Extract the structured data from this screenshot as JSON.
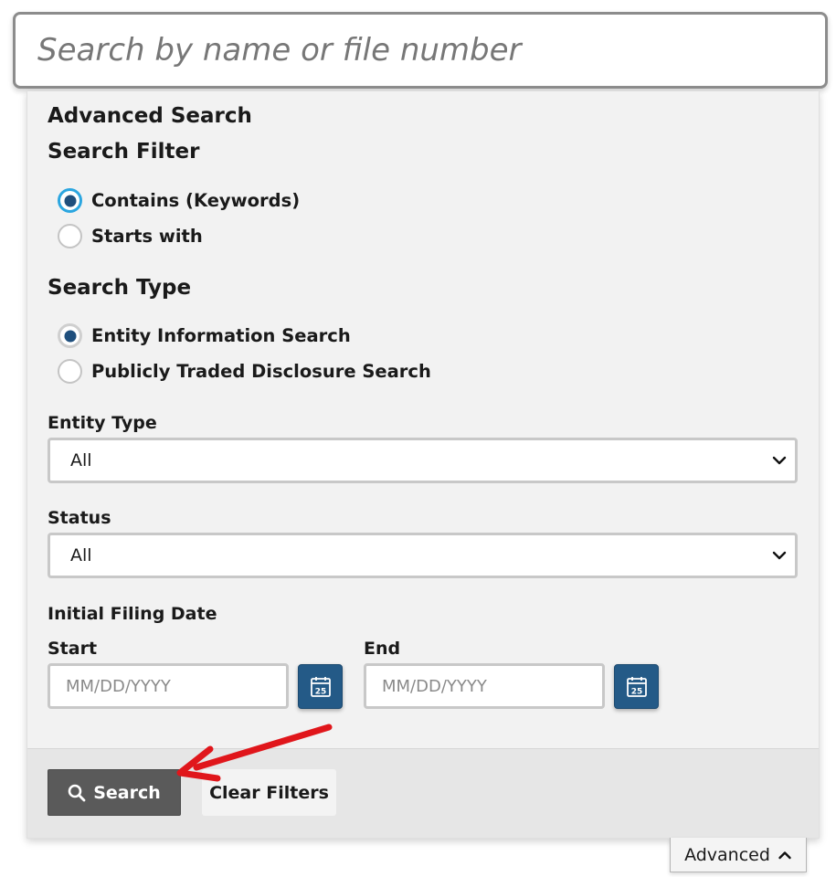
{
  "search": {
    "placeholder": "Search by name or file number"
  },
  "advanced_panel": {
    "title": "Advanced Search",
    "search_filter": {
      "heading": "Search Filter",
      "options": [
        {
          "label": "Contains (Keywords)",
          "selected": true
        },
        {
          "label": "Starts with",
          "selected": false
        }
      ]
    },
    "search_type": {
      "heading": "Search Type",
      "options": [
        {
          "label": "Entity Information Search",
          "selected": true
        },
        {
          "label": "Publicly Traded Disclosure Search",
          "selected": false
        }
      ]
    },
    "entity_type": {
      "label": "Entity Type",
      "value": "All"
    },
    "status": {
      "label": "Status",
      "value": "All"
    },
    "initial_filing_date": {
      "label": "Initial Filing Date",
      "start": {
        "label": "Start",
        "placeholder": "MM/DD/YYYY"
      },
      "end": {
        "label": "End",
        "placeholder": "MM/DD/YYYY"
      },
      "calendar_icon_day": "25"
    },
    "buttons": {
      "search": "Search",
      "clear": "Clear Filters"
    }
  },
  "advanced_toggle": {
    "label": "Advanced"
  },
  "colors": {
    "accent": "#245a87",
    "focus_ring": "#2ba6e0",
    "annotation_arrow": "#e0161b",
    "search_button": "#5a5a5a"
  },
  "icons": {
    "search": "search-icon",
    "calendar": "calendar-icon",
    "dropdown": "chevron-down-icon",
    "toggle": "chevron-up-icon"
  }
}
